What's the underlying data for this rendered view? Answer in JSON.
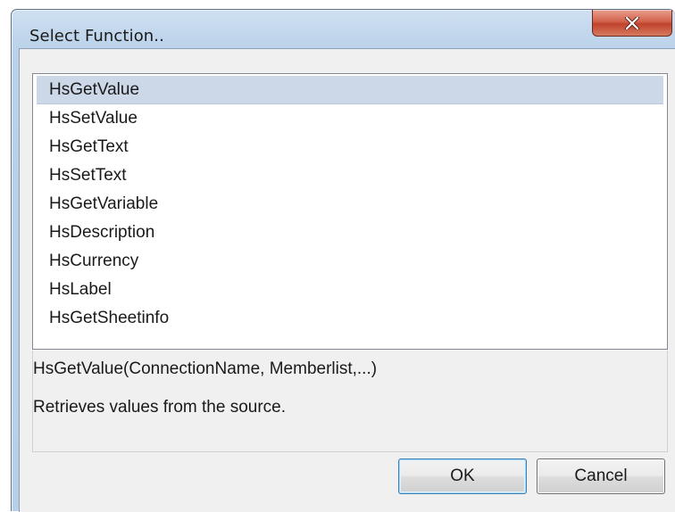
{
  "window": {
    "title": "Select Function.."
  },
  "function_list": {
    "selected_index": 0,
    "items": [
      "HsGetValue",
      "HsSetValue",
      "HsGetText",
      "HsSetText",
      "HsGetVariable",
      "HsDescription",
      "HsCurrency",
      "HsLabel",
      "HsGetSheetinfo"
    ]
  },
  "details": {
    "signature": "HsGetValue(ConnectionName, Memberlist,...)",
    "description": "Retrieves values from the source."
  },
  "buttons": {
    "ok": "OK",
    "cancel": "Cancel"
  },
  "colors": {
    "selection": "#ccd8e8",
    "close_button": "#c7503a",
    "frame": "#b9d1e9"
  }
}
